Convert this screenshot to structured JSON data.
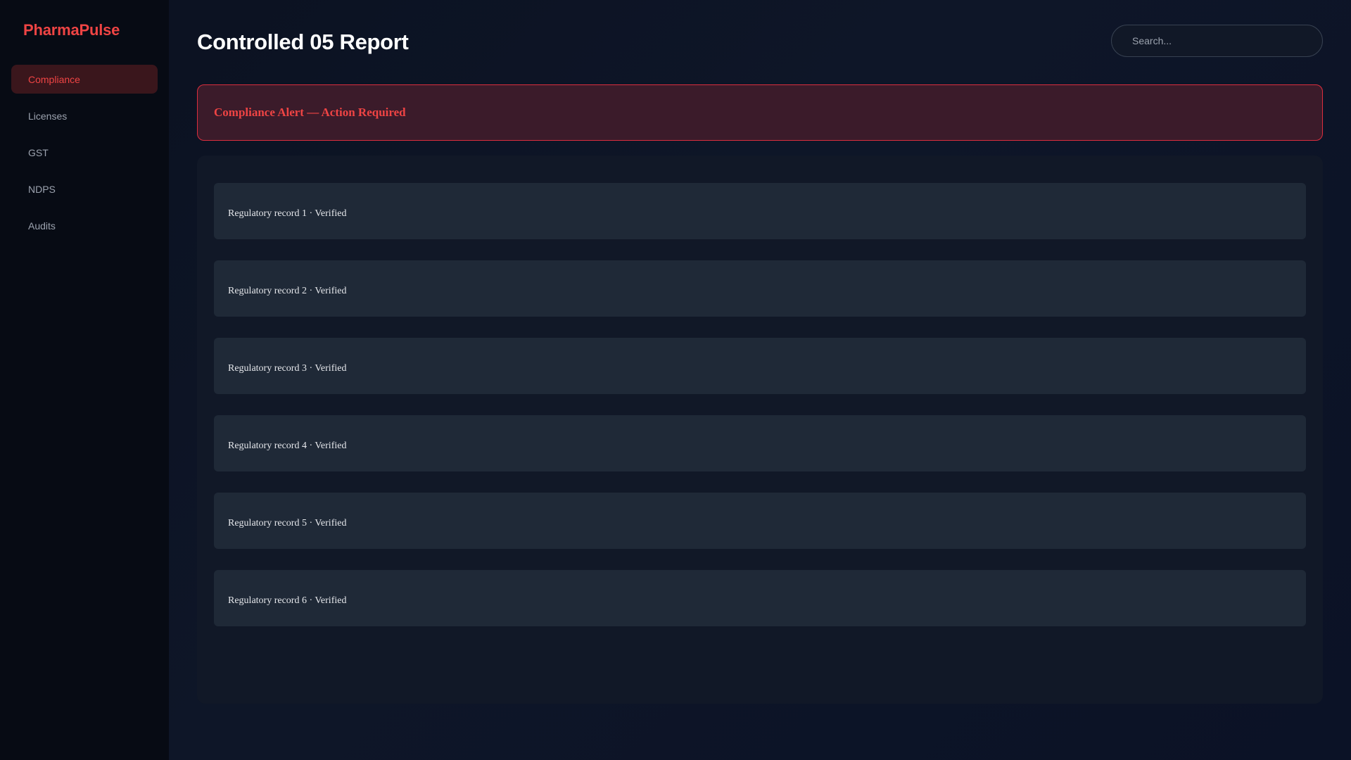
{
  "app": {
    "brand": "PharmaPulse"
  },
  "sidebar": {
    "items": [
      {
        "label": "Compliance",
        "active": true
      },
      {
        "label": "Licenses",
        "active": false
      },
      {
        "label": "GST",
        "active": false
      },
      {
        "label": "NDPS",
        "active": false
      },
      {
        "label": "Audits",
        "active": false
      }
    ]
  },
  "header": {
    "title": "Controlled 05 Report",
    "search_placeholder": "Search..."
  },
  "alert": {
    "text": "Compliance Alert — Action Required"
  },
  "records": [
    "Regulatory record 1 · Verified",
    "Regulatory record 2 · Verified",
    "Regulatory record 3 · Verified",
    "Regulatory record 4 · Verified",
    "Regulatory record 5 · Verified",
    "Regulatory record 6 · Verified"
  ],
  "colors": {
    "accent": "#ef4444",
    "background": "#0b1120",
    "sidebar": "#070b14",
    "panel": "#111827",
    "card": "#1f2937",
    "alert_bg": "#3b1b2a",
    "alert_border": "#dc2e3e"
  }
}
